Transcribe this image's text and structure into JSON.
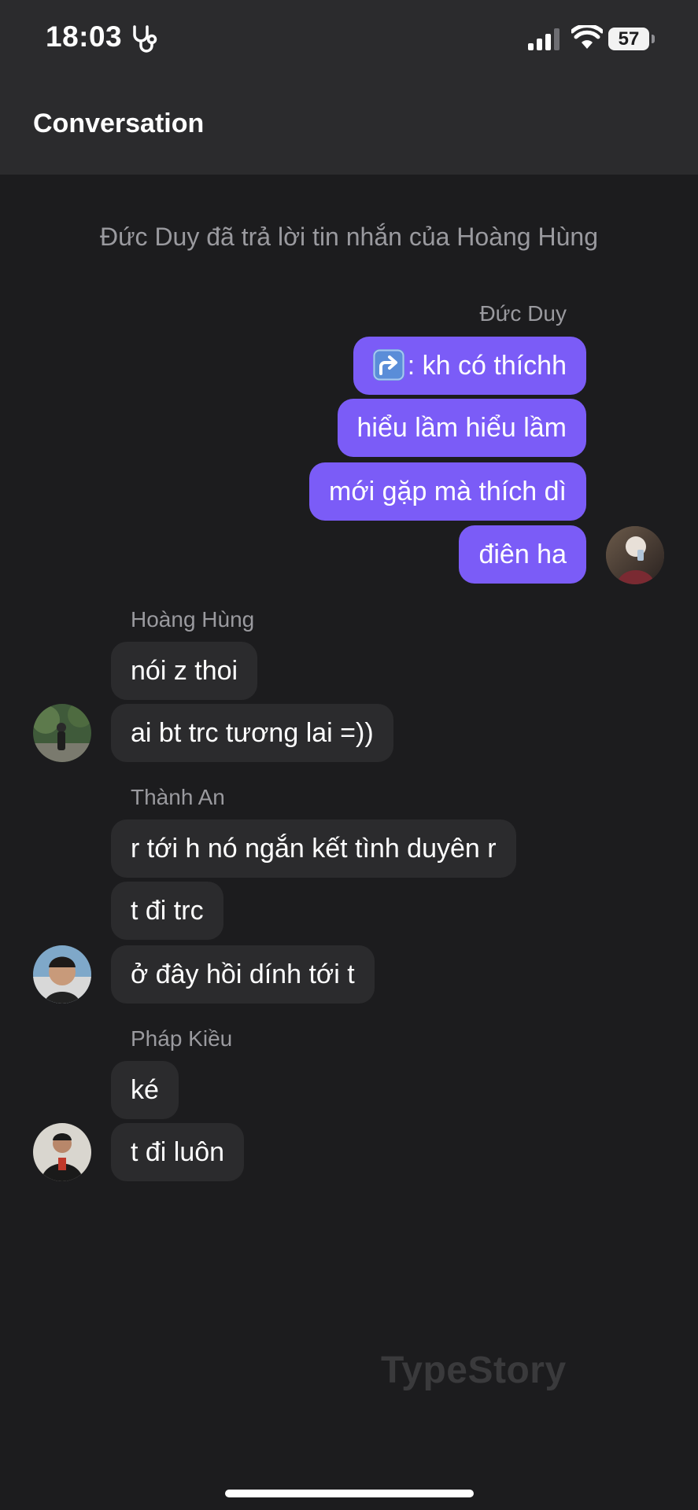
{
  "status_bar": {
    "time": "18:03",
    "battery": "57"
  },
  "header": {
    "title": "Conversation"
  },
  "system_message": "Đức Duy đã trả lời tin nhắn của Hoàng Hùng",
  "groups": [
    {
      "sender": "Đức Duy",
      "direction": "outgoing",
      "messages": [
        {
          "text": ": kh có thíchh",
          "reply_icon": "reply-arrow-icon"
        },
        {
          "text": "hiểu lầm hiểu lầm"
        },
        {
          "text": "mới gặp mà thích dì"
        },
        {
          "text": "điên ha"
        }
      ]
    },
    {
      "sender": "Hoàng Hùng",
      "direction": "incoming",
      "messages": [
        {
          "text": "nói z thoi"
        },
        {
          "text": "ai bt trc tương lai =))"
        }
      ]
    },
    {
      "sender": "Thành An",
      "direction": "incoming",
      "messages": [
        {
          "text": "r tới h nó ngắn kết tình duyên r"
        },
        {
          "text": "t đi trc"
        },
        {
          "text": "ở đây hồi dính tới t"
        }
      ]
    },
    {
      "sender": "Pháp Kiều",
      "direction": "incoming",
      "messages": [
        {
          "text": "ké"
        },
        {
          "text": "t đi luôn"
        }
      ]
    }
  ],
  "watermark": "TypeStory",
  "colors": {
    "background": "#1c1c1e",
    "bar": "#2b2b2d",
    "outgoing_bubble": "#7b5cf7",
    "incoming_bubble": "#2b2b2d",
    "muted_text": "#9a9a9f"
  }
}
